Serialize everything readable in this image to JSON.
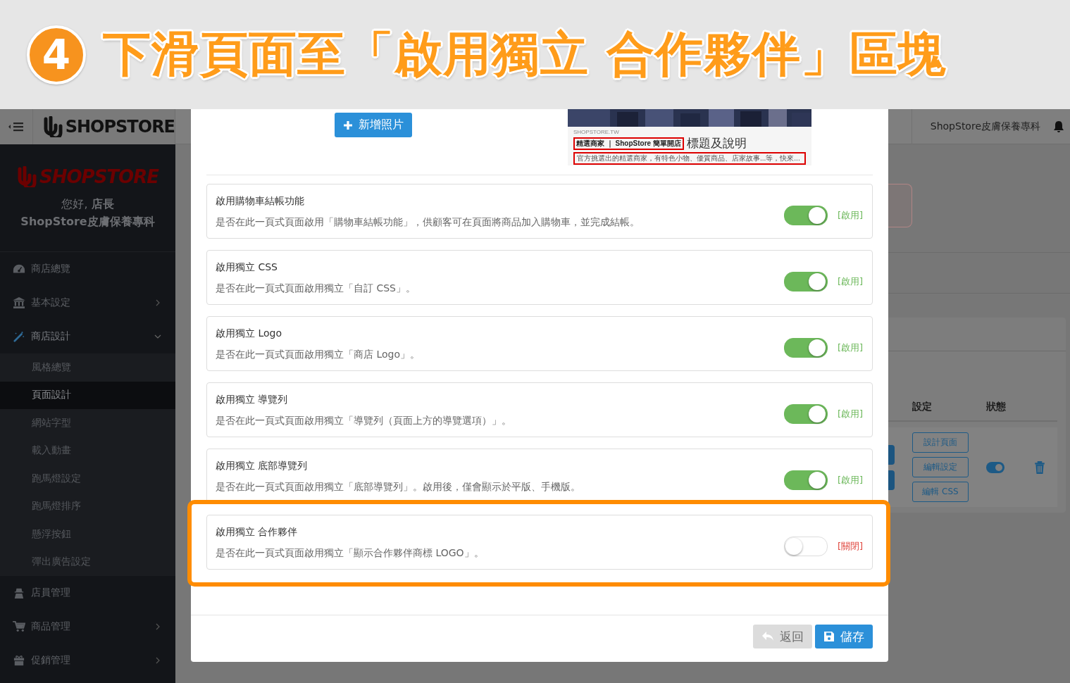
{
  "banner": {
    "step": "4",
    "title": "下滑頁面至「啟用獨立 合作夥伴」區塊"
  },
  "topbar": {
    "logo_text": "SHOPSTORE",
    "store_name": "ShopStore皮膚保養專科"
  },
  "sidebar": {
    "logo_text": "SHOPSTORE",
    "greeting": "您好, **店長**",
    "store_name": "ShopStore皮膚保養專科",
    "items": [
      {
        "label": "商店總覽"
      },
      {
        "label": "基本設定",
        "expanded": false
      },
      {
        "label": "商店設計",
        "expanded": true,
        "children": [
          {
            "label": "風格總覽",
            "selected": false
          },
          {
            "label": "頁面設計",
            "selected": true
          },
          {
            "label": "網站字型",
            "selected": false
          },
          {
            "label": "載入動畫",
            "selected": false
          },
          {
            "label": "跑馬燈設定",
            "selected": false
          },
          {
            "label": "跑馬燈排序",
            "selected": false
          },
          {
            "label": "懸浮按鈕",
            "selected": false
          },
          {
            "label": "彈出廣告設定",
            "selected": false
          }
        ]
      },
      {
        "label": "店員管理"
      },
      {
        "label": "商品管理",
        "expanded": false
      },
      {
        "label": "促銷管理",
        "expanded": false
      }
    ]
  },
  "table": {
    "columns": [
      "設定",
      "狀態"
    ],
    "actions": [
      "設計頁面",
      "編輯設定",
      "編輯 CSS"
    ],
    "status_on": true
  },
  "modal": {
    "add_photo_button": "新增照片",
    "ad_preview": {
      "site": "SHOPSTORE.TW",
      "title": "精選商家 ｜ ShopStore 簡單開店",
      "label": "標題及說明",
      "description": "官方挑選出的精選商家，有特色小物、優質商品、店家故事...等，快來..."
    },
    "settings": [
      {
        "title": "啟用購物車結帳功能",
        "description": "是否在此一頁式頁面啟用「購物車結帳功能」，供顧客可在頁面將商品加入購物車，並完成結帳。",
        "on": true,
        "status": "[啟用]",
        "highlighted": false
      },
      {
        "title": "啟用獨立 CSS",
        "description": "是否在此一頁式頁面啟用獨立「自訂 CSS」。",
        "on": true,
        "status": "[啟用]",
        "highlighted": false
      },
      {
        "title": "啟用獨立 Logo",
        "description": "是否在此一頁式頁面啟用獨立「商店 Logo」。",
        "on": true,
        "status": "[啟用]",
        "highlighted": false
      },
      {
        "title": "啟用獨立 導覽列",
        "description": "是否在此一頁式頁面啟用獨立「導覽列（頁面上方的導覽選項）」。",
        "on": true,
        "status": "[啟用]",
        "highlighted": false
      },
      {
        "title": "啟用獨立 底部導覽列",
        "description": "是否在此一頁式頁面啟用獨立「底部導覽列」。啟用後，僅會顯示於平版、手機版。",
        "on": true,
        "status": "[啟用]",
        "highlighted": false
      },
      {
        "title": "啟用獨立 合作夥伴",
        "description": "是否在此一頁式頁面啟用獨立「顯示合作夥伴商標 LOGO」。",
        "on": false,
        "status": "[關閉]",
        "highlighted": true
      }
    ],
    "back_button": {
      "label": "返回",
      "disabled": true
    },
    "save_button": "儲存"
  }
}
